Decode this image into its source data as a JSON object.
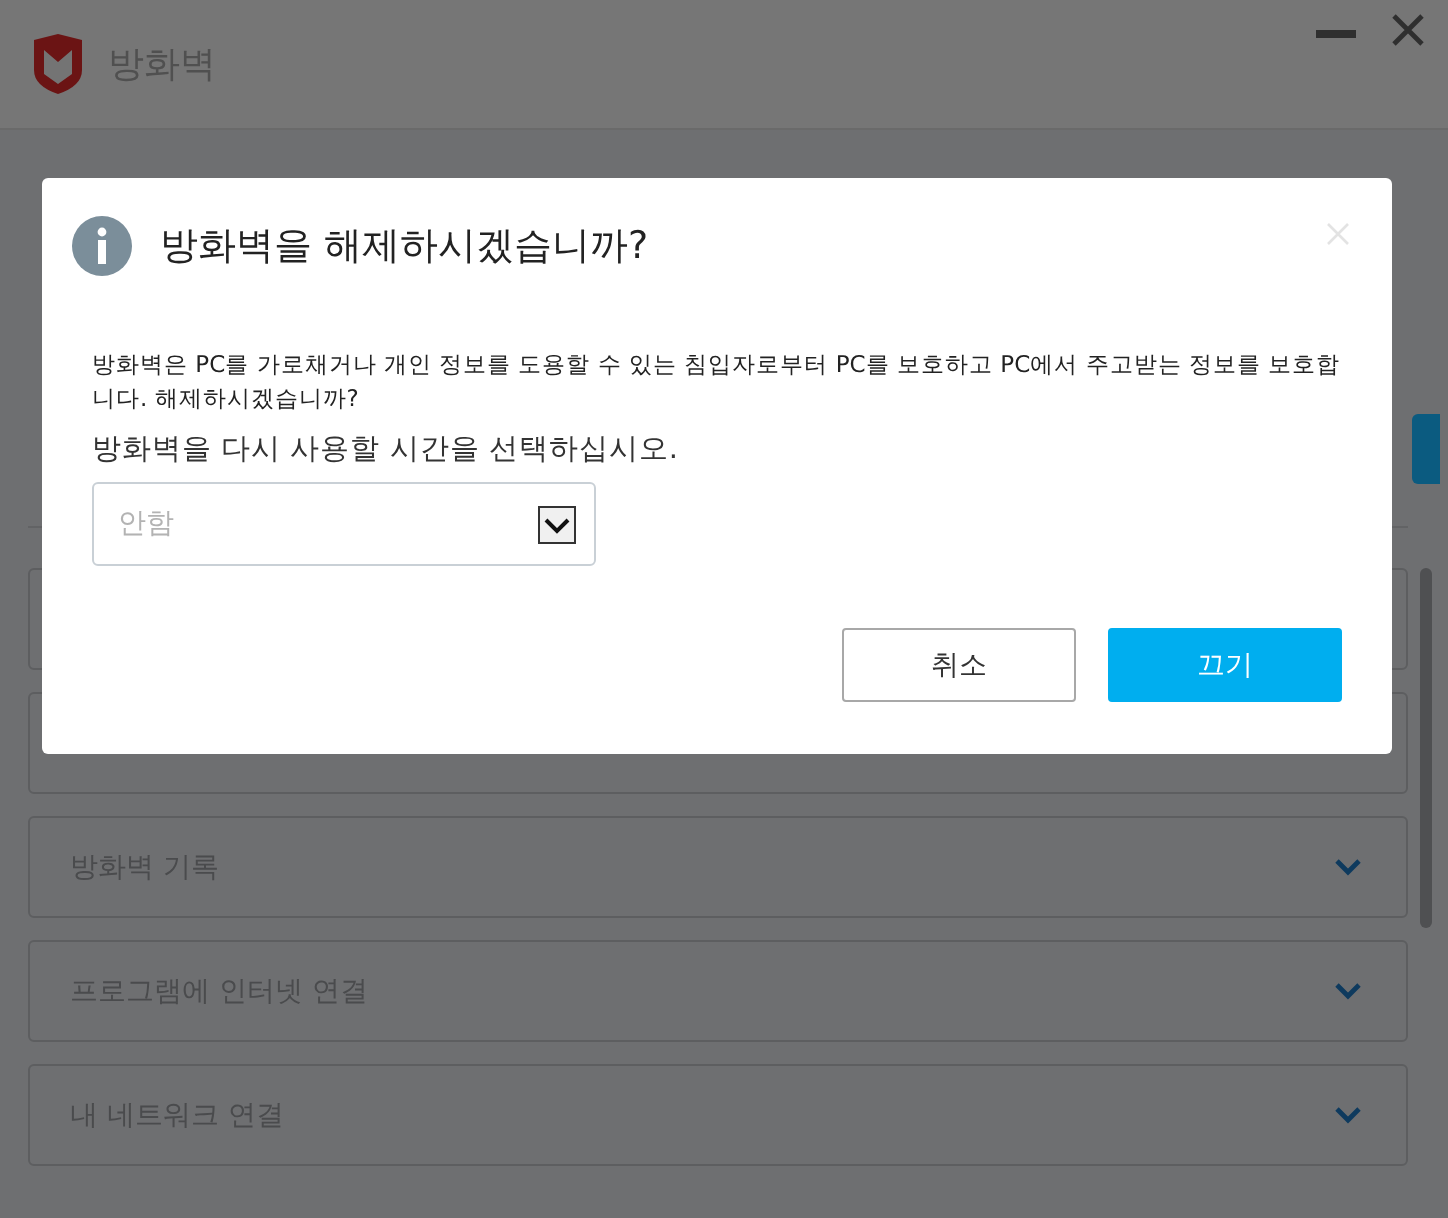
{
  "window": {
    "title": "방화벽"
  },
  "sections": [
    {
      "label": "방화벽 기록"
    },
    {
      "label": "프로그램에 인터넷 연결"
    },
    {
      "label": "내 네트워크 연결"
    }
  ],
  "dialog": {
    "title": "방화벽을 해제하시겠습니까?",
    "description": "방화벽은 PC를 가로채거나 개인 정보를 도용할 수 있는 침입자로부터 PC를 보호하고 PC에서 주고받는 정보를 보호합니다. 해제하시겠습니까?",
    "prompt": "방화벽을 다시 사용할 시간을 선택하십시오.",
    "select": {
      "placeholder": "안함"
    },
    "buttons": [
      {
        "label": "취소",
        "kind": "secondary"
      },
      {
        "label": "끄기",
        "kind": "primary"
      }
    ]
  }
}
